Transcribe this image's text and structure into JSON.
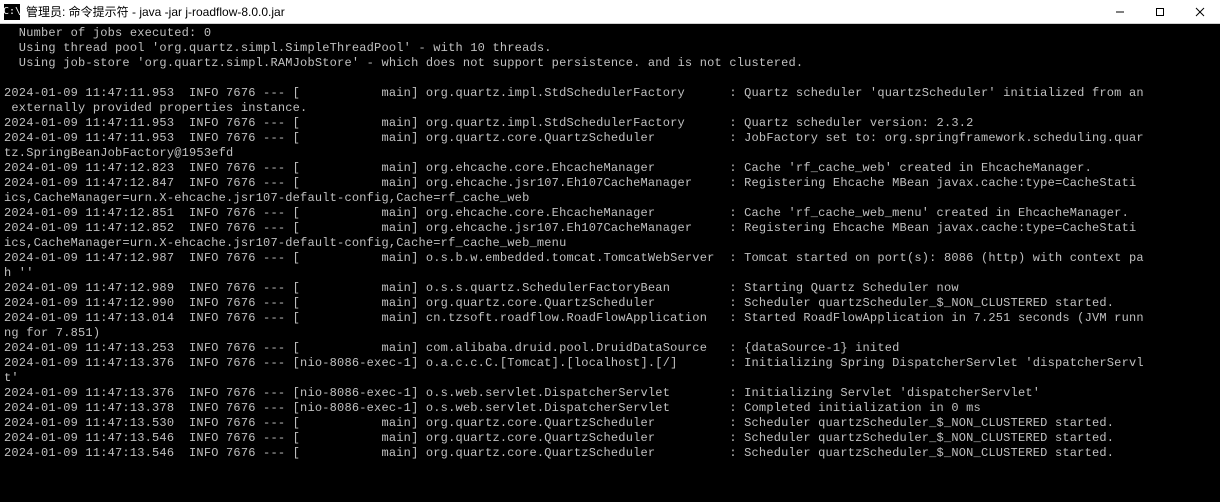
{
  "window": {
    "icon_label": "C:\\",
    "title": "管理员: 命令提示符 - java  -jar j-roadflow-8.0.0.jar"
  },
  "header_lines": [
    "  Number of jobs executed: 0",
    "  Using thread pool 'org.quartz.simpl.SimpleThreadPool' - with 10 threads.",
    "  Using job-store 'org.quartz.simpl.RAMJobStore' - which does not support persistence. and is not clustered.",
    ""
  ],
  "log_lines": [
    "2024-01-09 11:47:11.953  INFO 7676 --- [           main] org.quartz.impl.StdSchedulerFactory      : Quartz scheduler 'quartzScheduler' initialized from an",
    " externally provided properties instance.",
    "2024-01-09 11:47:11.953  INFO 7676 --- [           main] org.quartz.impl.StdSchedulerFactory      : Quartz scheduler version: 2.3.2",
    "2024-01-09 11:47:11.953  INFO 7676 --- [           main] org.quartz.core.QuartzScheduler          : JobFactory set to: org.springframework.scheduling.quar",
    "tz.SpringBeanJobFactory@1953efd",
    "2024-01-09 11:47:12.823  INFO 7676 --- [           main] org.ehcache.core.EhcacheManager          : Cache 'rf_cache_web' created in EhcacheManager.",
    "2024-01-09 11:47:12.847  INFO 7676 --- [           main] org.ehcache.jsr107.Eh107CacheManager     : Registering Ehcache MBean javax.cache:type=CacheStati",
    "ics,CacheManager=urn.X-ehcache.jsr107-default-config,Cache=rf_cache_web",
    "2024-01-09 11:47:12.851  INFO 7676 --- [           main] org.ehcache.core.EhcacheManager          : Cache 'rf_cache_web_menu' created in EhcacheManager.",
    "2024-01-09 11:47:12.852  INFO 7676 --- [           main] org.ehcache.jsr107.Eh107CacheManager     : Registering Ehcache MBean javax.cache:type=CacheStati",
    "ics,CacheManager=urn.X-ehcache.jsr107-default-config,Cache=rf_cache_web_menu",
    "2024-01-09 11:47:12.987  INFO 7676 --- [           main] o.s.b.w.embedded.tomcat.TomcatWebServer  : Tomcat started on port(s): 8086 (http) with context pa",
    "h ''",
    "2024-01-09 11:47:12.989  INFO 7676 --- [           main] o.s.s.quartz.SchedulerFactoryBean        : Starting Quartz Scheduler now",
    "2024-01-09 11:47:12.990  INFO 7676 --- [           main] org.quartz.core.QuartzScheduler          : Scheduler quartzScheduler_$_NON_CLUSTERED started.",
    "2024-01-09 11:47:13.014  INFO 7676 --- [           main] cn.tzsoft.roadflow.RoadFlowApplication   : Started RoadFlowApplication in 7.251 seconds (JVM runn",
    "ng for 7.851)",
    "2024-01-09 11:47:13.253  INFO 7676 --- [           main] com.alibaba.druid.pool.DruidDataSource   : {dataSource-1} inited",
    "2024-01-09 11:47:13.376  INFO 7676 --- [nio-8086-exec-1] o.a.c.c.C.[Tomcat].[localhost].[/]       : Initializing Spring DispatcherServlet 'dispatcherServl",
    "t'",
    "2024-01-09 11:47:13.376  INFO 7676 --- [nio-8086-exec-1] o.s.web.servlet.DispatcherServlet        : Initializing Servlet 'dispatcherServlet'",
    "2024-01-09 11:47:13.378  INFO 7676 --- [nio-8086-exec-1] o.s.web.servlet.DispatcherServlet        : Completed initialization in 0 ms",
    "2024-01-09 11:47:13.530  INFO 7676 --- [           main] org.quartz.core.QuartzScheduler          : Scheduler quartzScheduler_$_NON_CLUSTERED started.",
    "2024-01-09 11:47:13.546  INFO 7676 --- [           main] org.quartz.core.QuartzScheduler          : Scheduler quartzScheduler_$_NON_CLUSTERED started.",
    "2024-01-09 11:47:13.546  INFO 7676 --- [           main] org.quartz.core.QuartzScheduler          : Scheduler quartzScheduler_$_NON_CLUSTERED started."
  ]
}
